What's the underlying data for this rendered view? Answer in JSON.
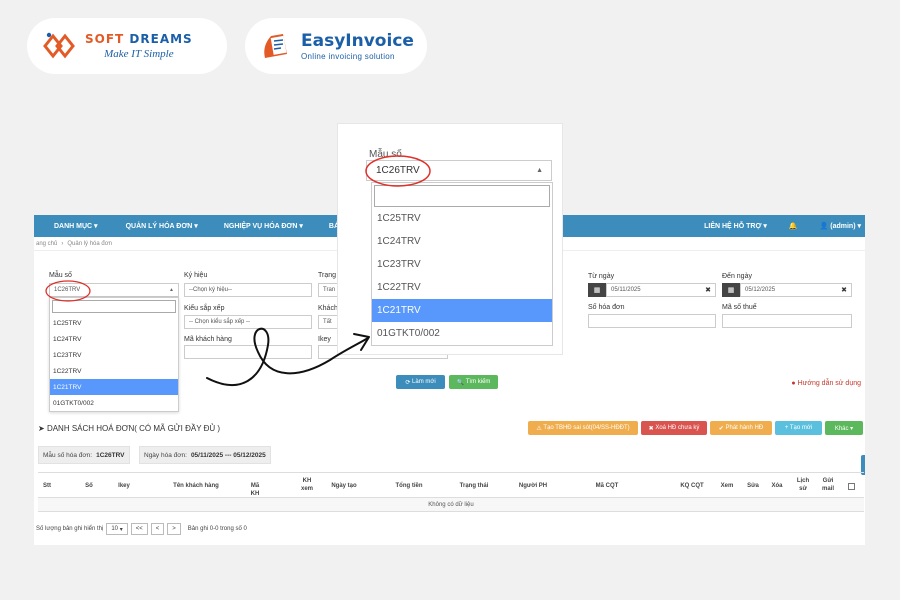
{
  "logos": {
    "softdreams": {
      "brand_left": "SOFT",
      "brand_right": "DREAMS",
      "slogan": "Make IT Simple"
    },
    "easyinvoice": {
      "brand_left": "Easy",
      "brand_right": "Invoice",
      "slogan": "Online invoicing solution"
    }
  },
  "navbar": {
    "items": [
      "DANH MỤC ▾",
      "QUẢN LÝ HÓA ĐƠN ▾",
      "NGHIỆP VỤ HÓA ĐƠN ▾",
      "BÁO"
    ],
    "support": "LIÊN HỆ HỖ TRỢ ▾",
    "user": "(admin) ▾"
  },
  "breadcrumb": {
    "home": "ang chủ",
    "sep": "›",
    "current": "Quản lý hóa đơn"
  },
  "filters": {
    "mau_so": {
      "label": "Mẫu số",
      "value": "1C26TRV"
    },
    "ky_hieu": {
      "label": "Ký hiệu",
      "value": "--Chọn ký hiệu--"
    },
    "trang_thai": {
      "label": "Trạng",
      "value": "Tran"
    },
    "kieu_sap_xep": {
      "label": "Kiểu sắp xếp",
      "value": "-- Chọn kiểu sắp xếp --"
    },
    "khach": {
      "label": "Khách",
      "value": "Tất"
    },
    "ma_khach_hang": {
      "label": "Mã khách hàng"
    },
    "ikey": {
      "label": "Ikey"
    },
    "tu_ngay": {
      "label": "Từ ngày",
      "value": "05/11/2025"
    },
    "den_ngay": {
      "label": "Đến ngày",
      "value": "05/12/2025"
    },
    "so_hoa_don": {
      "label": "Số hóa đơn"
    },
    "ma_so_thue": {
      "label": "Mã số thuế"
    }
  },
  "dropdown_options": [
    "1C25TRV",
    "1C24TRV",
    "1C23TRV",
    "1C22TRV",
    "1C21TRV",
    "01GTKT0/002"
  ],
  "dropdown_selected_index": 4,
  "zoom": {
    "label": "Mẫu số",
    "value": "1C26TRV"
  },
  "buttons": {
    "lam_moi": "Làm mới",
    "tim_kiem": "Tìm kiếm",
    "tao_tbhd": "Tạo TBHĐ sai sót(04/SS-HĐĐT)",
    "xoa_hd": "Xoá HĐ chưa ký",
    "phat_hanh": "Phát hành HĐ",
    "tao_moi": "+ Tạo mới",
    "khac": "Khác ▾"
  },
  "help": "Hướng dẫn sử dụng",
  "list": {
    "title": "DANH SÁCH HOÁ ĐƠN( CÓ MÃ GỬI ĐẦY ĐỦ )",
    "chip1_label": "Mẫu số hóa đơn:",
    "chip1_value": "1C26TRV",
    "chip2_label": "Ngày hóa đơn:",
    "chip2_value": "05/11/2025 --- 05/12/2025",
    "columns": [
      "Stt",
      "Số",
      "Ikey",
      "Tên khách hàng",
      "Mã KH",
      "KH xem",
      "Ngày tạo",
      "Tổng tiền",
      "Trạng thái",
      "Người PH",
      "Mã CQT",
      "KQ CQT",
      "Xem",
      "Sửa",
      "Xóa",
      "Lịch sử",
      "Gửi mail"
    ],
    "empty": "Không có dữ liệu"
  },
  "pager": {
    "label": "Số lượng bản ghi hiển thị",
    "size": "10",
    "first": "<<",
    "prev": "<",
    "next": ">",
    "summary": "Bản ghi 0-0 trong số 0"
  },
  "colors": {
    "navbar": "#3c8dbc",
    "selected": "#5897fb",
    "annotation": "#e0302a",
    "brand_orange": "#e35a26",
    "brand_blue": "#1b5fa8"
  }
}
